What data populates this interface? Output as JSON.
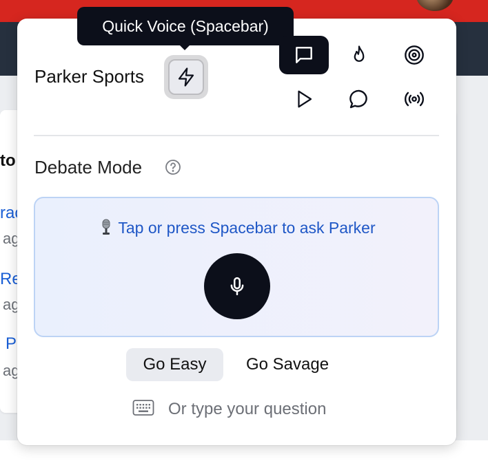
{
  "background": {
    "card_heading_fragment": "to",
    "link_fragments": [
      "rac",
      "Re",
      "P"
    ],
    "sub_fragments": [
      "ag",
      "ag",
      "ag"
    ]
  },
  "tooltip": {
    "text": "Quick Voice (Spacebar)"
  },
  "header": {
    "brand": "Parker Sports",
    "quick_voice_icon": "lightning-icon",
    "icons": [
      "chat-icon",
      "flame-icon",
      "target-icon",
      "play-icon",
      "comment-icon",
      "broadcast-icon"
    ],
    "active_icon": "chat-icon"
  },
  "mode": {
    "label": "Debate Mode",
    "help_icon": "help-circle-icon"
  },
  "voice": {
    "prompt": "Tap or press Spacebar to ask Parker",
    "prompt_icon": "studio-microphone-emoji",
    "mic_icon": "microphone-icon"
  },
  "tones": {
    "easy": "Go Easy",
    "savage": "Go Savage",
    "selected": "Go Easy"
  },
  "type_prompt": {
    "label": "Or type your question",
    "icon": "keyboard-icon"
  },
  "colors": {
    "accent_dark": "#0c0f1a",
    "link_blue": "#1f57c6",
    "topbar_red": "#d6261f",
    "voice_box_border": "#bcd3f5"
  }
}
